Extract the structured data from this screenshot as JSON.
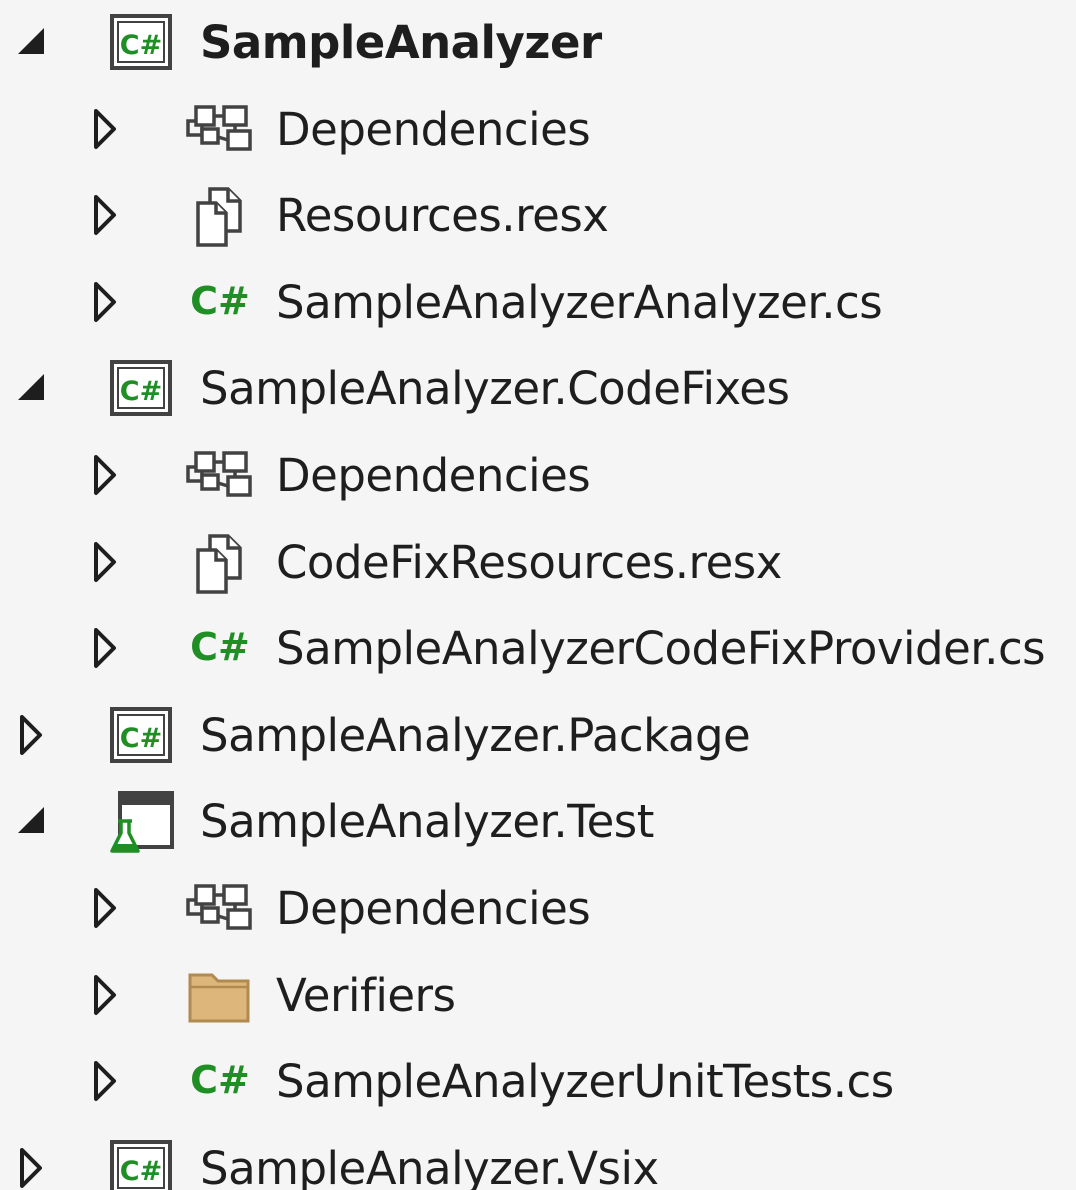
{
  "tree": [
    {
      "label": "SampleAnalyzer",
      "level": 0,
      "expanded": true,
      "icon": "csharp-project-icon",
      "bold": true
    },
    {
      "label": "Dependencies",
      "level": 1,
      "expanded": false,
      "icon": "dependencies-icon"
    },
    {
      "label": "Resources.resx",
      "level": 1,
      "expanded": false,
      "icon": "resource-file-icon"
    },
    {
      "label": "SampleAnalyzerAnalyzer.cs",
      "level": 1,
      "expanded": false,
      "icon": "csharp-file-icon"
    },
    {
      "label": "SampleAnalyzer.CodeFixes",
      "level": 0,
      "expanded": true,
      "icon": "csharp-project-icon"
    },
    {
      "label": "Dependencies",
      "level": 1,
      "expanded": false,
      "icon": "dependencies-icon"
    },
    {
      "label": "CodeFixResources.resx",
      "level": 1,
      "expanded": false,
      "icon": "resource-file-icon"
    },
    {
      "label": "SampleAnalyzerCodeFixProvider.cs",
      "level": 1,
      "expanded": false,
      "icon": "csharp-file-icon"
    },
    {
      "label": "SampleAnalyzer.Package",
      "level": 0,
      "expanded": false,
      "icon": "csharp-project-icon"
    },
    {
      "label": "SampleAnalyzer.Test",
      "level": 0,
      "expanded": true,
      "icon": "test-project-icon"
    },
    {
      "label": "Dependencies",
      "level": 1,
      "expanded": false,
      "icon": "dependencies-icon"
    },
    {
      "label": "Verifiers",
      "level": 1,
      "expanded": false,
      "icon": "folder-icon"
    },
    {
      "label": "SampleAnalyzerUnitTests.cs",
      "level": 1,
      "expanded": false,
      "icon": "csharp-file-icon"
    },
    {
      "label": "SampleAnalyzer.Vsix",
      "level": 0,
      "expanded": false,
      "icon": "csharp-project-icon"
    }
  ],
  "colors": {
    "background": "#f5f5f5",
    "text": "#1e1e1e",
    "csharp_green": "#1f8f25",
    "folder_fill": "#dcb67a",
    "folder_stroke": "#b08a4e",
    "glyph_gray": "#424242"
  }
}
